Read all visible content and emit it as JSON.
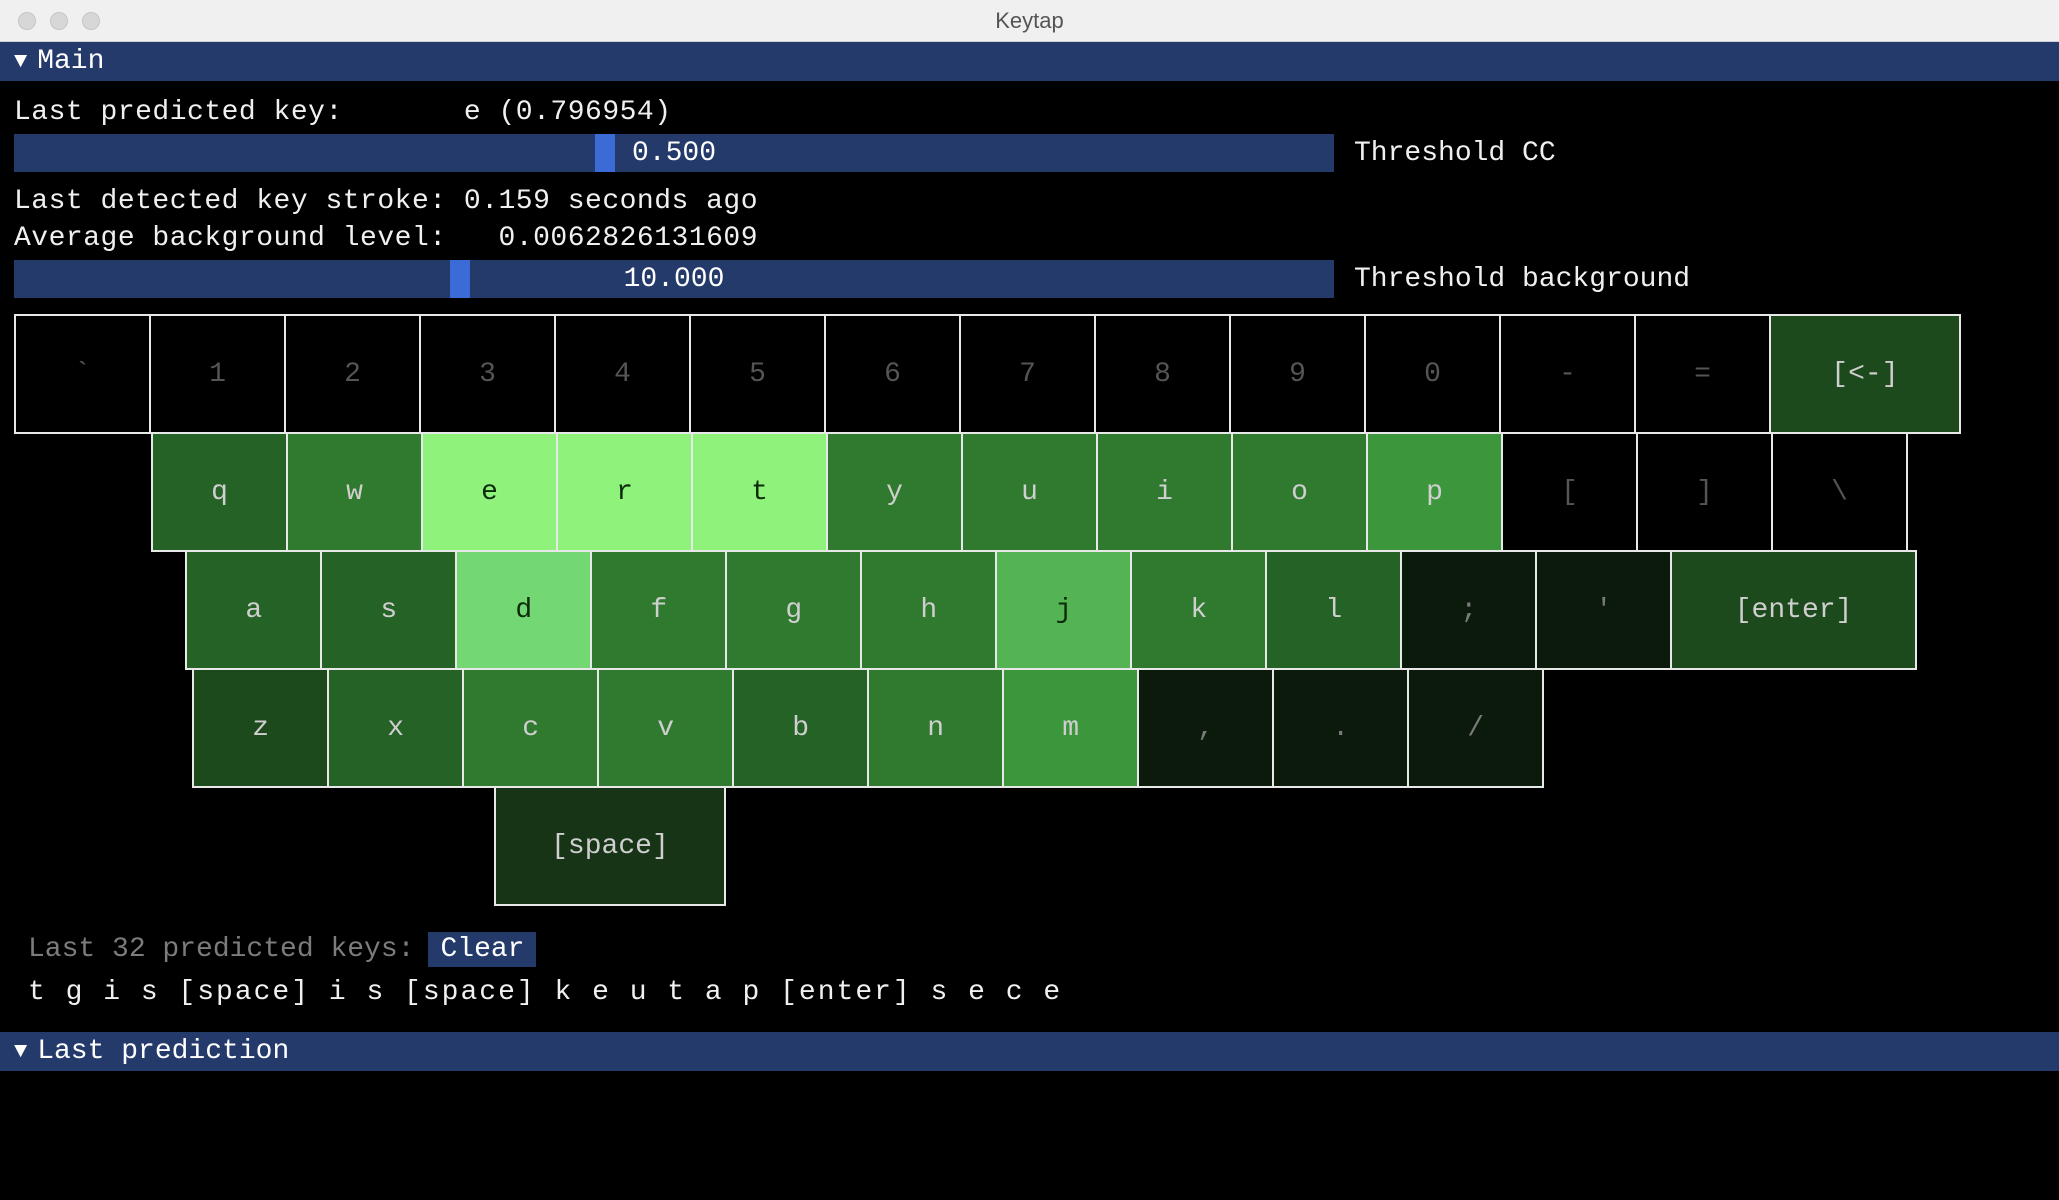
{
  "window": {
    "title": "Keytap"
  },
  "sections": {
    "main": "Main",
    "last_prediction": "Last prediction"
  },
  "status": {
    "last_predicted_key_label": "Last predicted key:",
    "last_predicted_key_value": "e (0.796954)",
    "last_detected_label": "Last detected key stroke:",
    "last_detected_value": "0.159 seconds ago",
    "avg_bg_label": "Average background level:",
    "avg_bg_value": "0.0062826131609"
  },
  "sliders": {
    "cc": {
      "value": "0.500",
      "label": "Threshold CC",
      "pos_pct": 44
    },
    "bg": {
      "value": "10.000",
      "label": "Threshold background",
      "pos_pct": 33
    }
  },
  "keyboard": {
    "key_w": 137,
    "key_h": 120,
    "rows": [
      {
        "offset_keys": 0,
        "keys": [
          {
            "label": "`",
            "heat": 0
          },
          {
            "label": "1",
            "heat": 0
          },
          {
            "label": "2",
            "heat": 0
          },
          {
            "label": "3",
            "heat": 0
          },
          {
            "label": "4",
            "heat": 0
          },
          {
            "label": "5",
            "heat": 0
          },
          {
            "label": "6",
            "heat": 0
          },
          {
            "label": "7",
            "heat": 0
          },
          {
            "label": "8",
            "heat": 0
          },
          {
            "label": "9",
            "heat": 0
          },
          {
            "label": "0",
            "heat": 0
          },
          {
            "label": "-",
            "heat": 0
          },
          {
            "label": "=",
            "heat": 0
          },
          {
            "label": "[<-]",
            "heat": 3,
            "wide": 1.4
          }
        ]
      },
      {
        "offset_keys": 1,
        "keys": [
          {
            "label": "q",
            "heat": 4
          },
          {
            "label": "w",
            "heat": 5
          },
          {
            "label": "e",
            "heat": 9
          },
          {
            "label": "r",
            "heat": 9
          },
          {
            "label": "t",
            "heat": 9
          },
          {
            "label": "y",
            "heat": 5
          },
          {
            "label": "u",
            "heat": 5
          },
          {
            "label": "i",
            "heat": 5
          },
          {
            "label": "o",
            "heat": 5
          },
          {
            "label": "p",
            "heat": 6
          },
          {
            "label": "[",
            "heat": 0
          },
          {
            "label": "]",
            "heat": 0
          },
          {
            "label": "\\",
            "heat": 0
          }
        ]
      },
      {
        "offset_keys": 1.25,
        "keys": [
          {
            "label": "a",
            "heat": 4
          },
          {
            "label": "s",
            "heat": 4
          },
          {
            "label": "d",
            "heat": 8
          },
          {
            "label": "f",
            "heat": 5
          },
          {
            "label": "g",
            "heat": 5
          },
          {
            "label": "h",
            "heat": 5
          },
          {
            "label": "j",
            "heat": 7
          },
          {
            "label": "k",
            "heat": 5
          },
          {
            "label": "l",
            "heat": 4
          },
          {
            "label": ";",
            "heat": 1
          },
          {
            "label": "'",
            "heat": 1
          },
          {
            "label": "[enter]",
            "heat": 3,
            "wide": 1.8
          }
        ]
      },
      {
        "offset_keys": 1.3,
        "keys": [
          {
            "label": "z",
            "heat": 3
          },
          {
            "label": "x",
            "heat": 4
          },
          {
            "label": "c",
            "heat": 5
          },
          {
            "label": "v",
            "heat": 5
          },
          {
            "label": "b",
            "heat": 4
          },
          {
            "label": "n",
            "heat": 5
          },
          {
            "label": "m",
            "heat": 6
          },
          {
            "label": ",",
            "heat": 1
          },
          {
            "label": ".",
            "heat": 1
          },
          {
            "label": "/",
            "heat": 1
          }
        ]
      },
      {
        "offset_keys": 3.5,
        "keys": [
          {
            "label": "[space]",
            "heat": 2,
            "wide": 1.7
          }
        ]
      }
    ]
  },
  "history": {
    "label": "Last 32 predicted keys:",
    "clear_label": "Clear",
    "text": "t g i s [space] i s [space] k e u t a p [enter] s e c e"
  }
}
